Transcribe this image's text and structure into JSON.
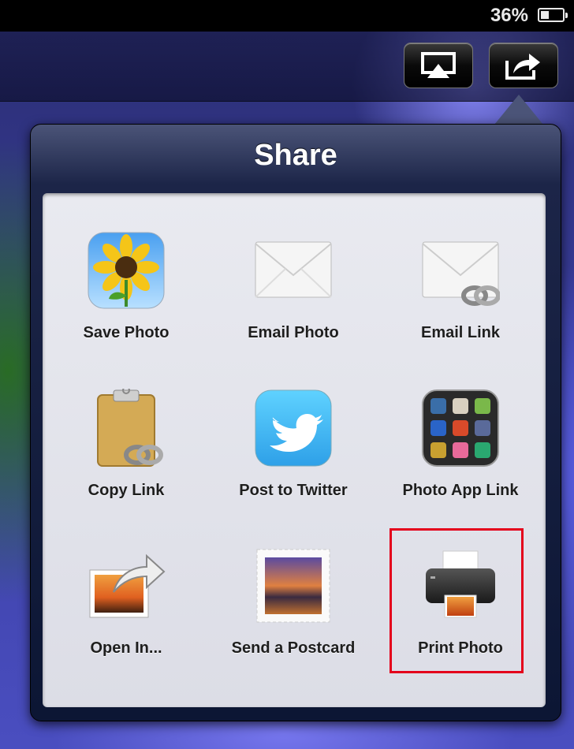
{
  "status_bar": {
    "battery_percent": "36%",
    "battery_icon": "battery-charging-icon"
  },
  "toolbar": {
    "airplay_icon": "airplay-icon",
    "share_icon": "share-arrow-icon"
  },
  "popover": {
    "title": "Share",
    "items": [
      {
        "label": "Save Photo",
        "icon": "sunflower-photos-icon"
      },
      {
        "label": "Email Photo",
        "icon": "envelope-icon"
      },
      {
        "label": "Email Link",
        "icon": "envelope-link-icon"
      },
      {
        "label": "Copy Link",
        "icon": "clipboard-link-icon"
      },
      {
        "label": "Post to Twitter",
        "icon": "twitter-bird-icon"
      },
      {
        "label": "Photo App Link",
        "icon": "app-folder-icon"
      },
      {
        "label": "Open In...",
        "icon": "open-in-arrow-icon"
      },
      {
        "label": "Send a Postcard",
        "icon": "postcard-stamp-icon"
      },
      {
        "label": "Print Photo",
        "icon": "printer-icon"
      }
    ]
  },
  "highlight_color": "#e4001b"
}
